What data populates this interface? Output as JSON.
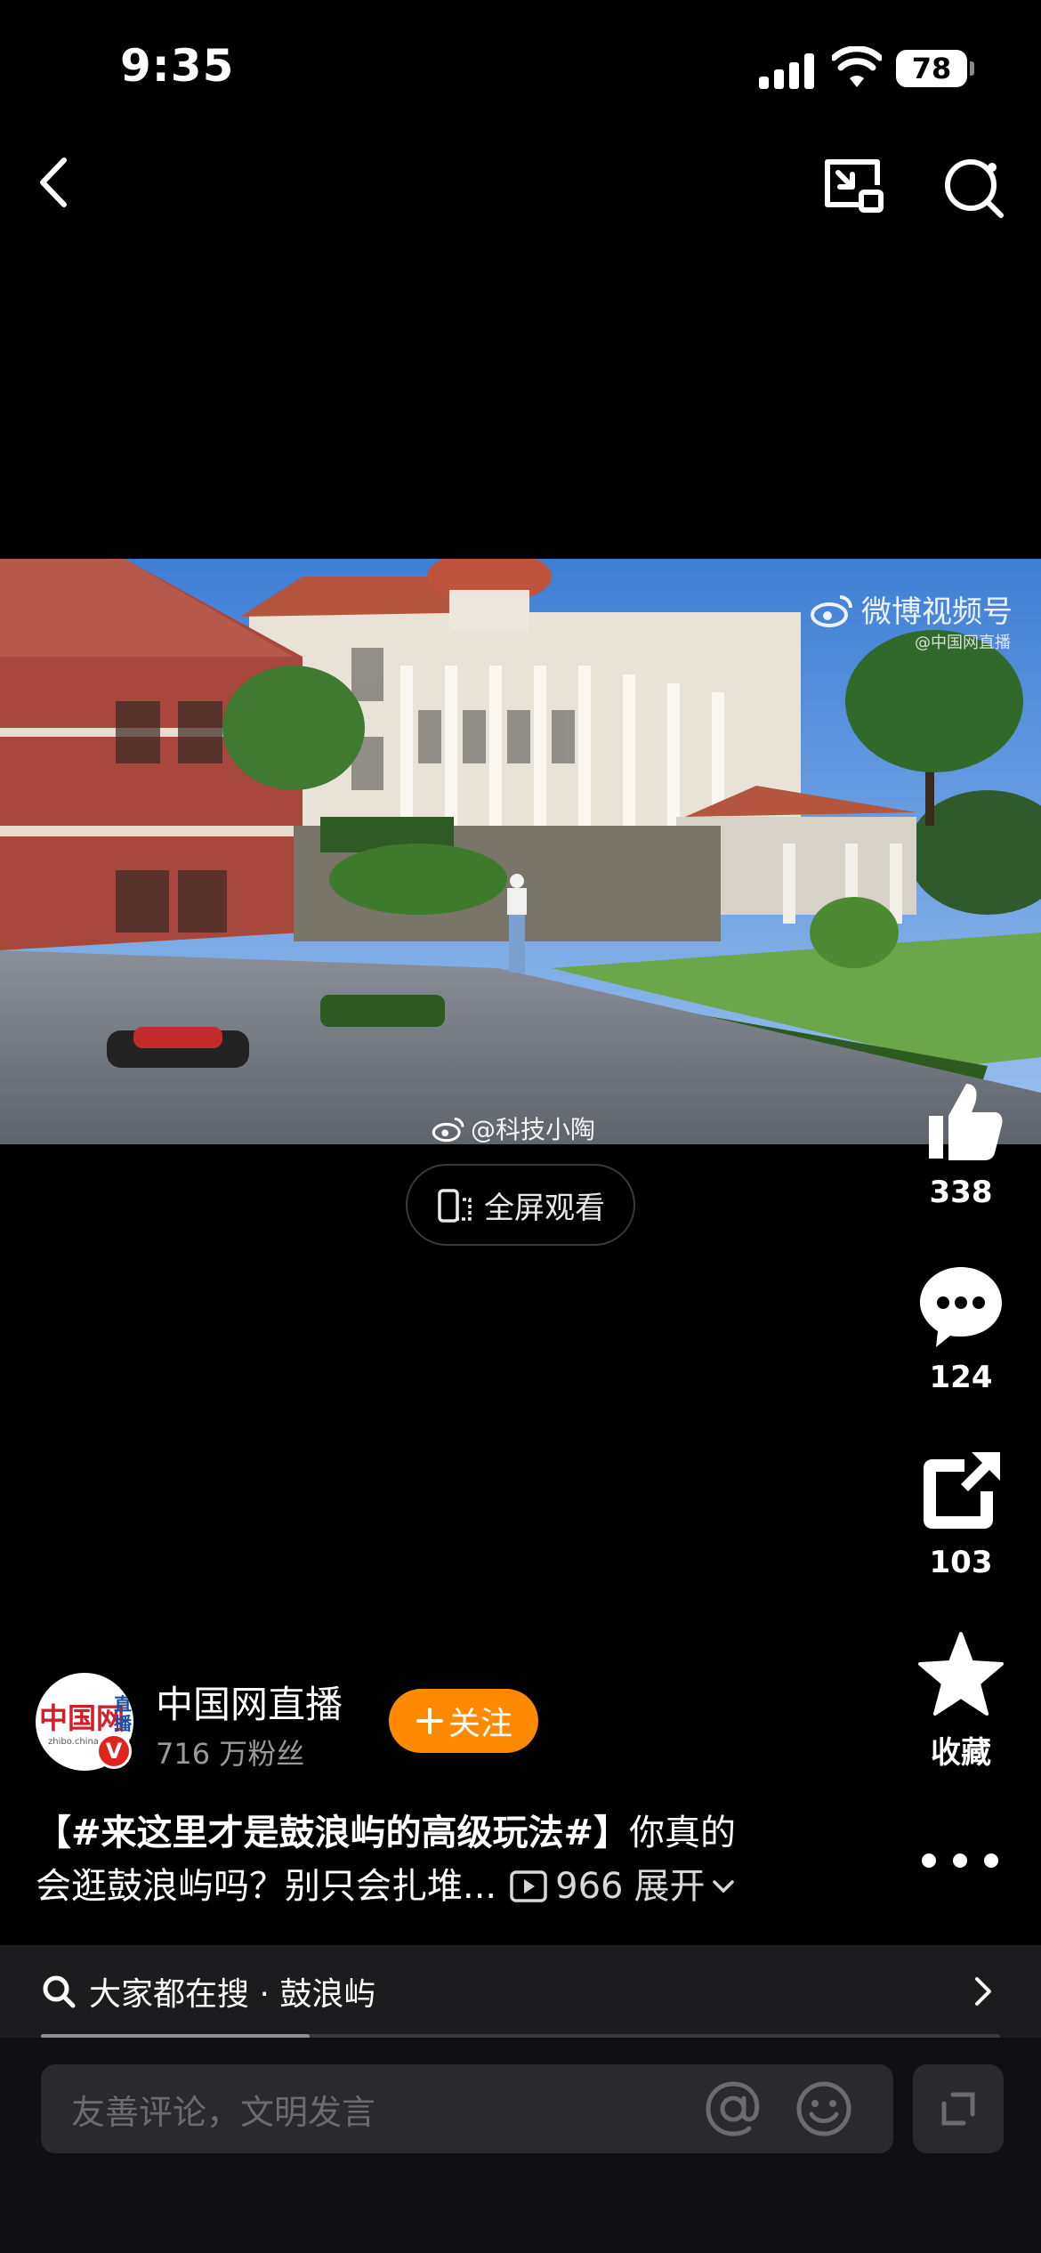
{
  "status_bar": {
    "time": "9:35",
    "battery": "78"
  },
  "video": {
    "watermark_brand": "微博视频号",
    "watermark_source": "@中国网直播",
    "author_watermark": "@科技小陶"
  },
  "fullscreen_label": "全屏观看",
  "actions": {
    "like_count": "338",
    "comment_count": "124",
    "share_count": "103",
    "favorite_label": "收藏"
  },
  "author": {
    "name": "中国网直播",
    "fans": "716 万粉丝",
    "follow_label": "关注",
    "avatar_logo": "中国网",
    "avatar_side": "直播",
    "avatar_url": "zhibo.china.com.cn",
    "verify_badge": "V"
  },
  "caption": {
    "hashtag": "【#来这里才是鼓浪屿的高级玩法#】",
    "text_line1": "你真的",
    "text_line2": "会逛鼓浪屿吗？别只会扎堆...",
    "views": "966",
    "expand_label": "展开"
  },
  "hot_search": {
    "text": "大家都在搜 · 鼓浪屿",
    "progress": 0.28
  },
  "comment_bar": {
    "placeholder": "友善评论，文明发言"
  }
}
